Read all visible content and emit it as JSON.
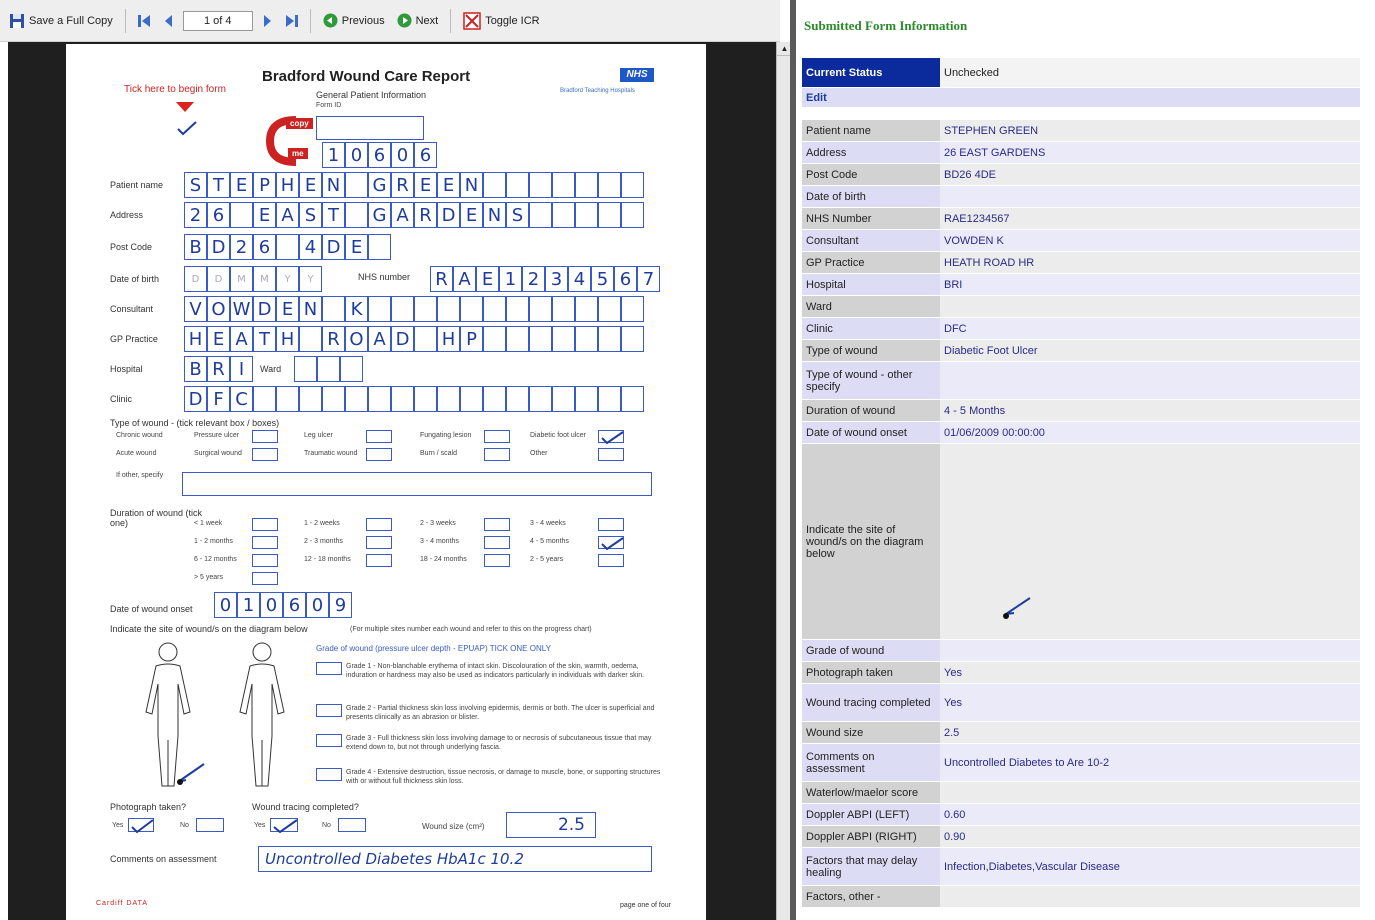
{
  "toolbar": {
    "save_label": "Save a Full Copy",
    "page_indicator": "1 of 4",
    "previous_label": "Previous",
    "next_label": "Next",
    "toggle_label": "Toggle ICR"
  },
  "form": {
    "title": "Bradford Wound Care Report",
    "subtitle": "General Patient Information",
    "tick_hint": "Tick here to begin form",
    "form_id_label": "Form ID",
    "nhs_logo": "NHS",
    "trust_name": "Bradford Teaching Hospitals",
    "copy_label": "copy",
    "me_label": "me",
    "form_id": "10606",
    "patient_name_label": "Patient name",
    "patient_name": "STEPHEN GREEN",
    "address_label": "Address",
    "address": "26 EAST GARDENS",
    "postcode_label": "Post Code",
    "postcode": "BD26 4DE",
    "dob_label": "Date of birth",
    "dob_placeholder": "DDMMYY",
    "nhs_number_label": "NHS number",
    "nhs_number": "RAE1234567",
    "consultant_label": "Consultant",
    "consultant": "VOWDEN K",
    "gp_label": "GP Practice",
    "gp": "HEATH ROAD HP",
    "hospital_label": "Hospital",
    "hospital": "BRI",
    "ward_label": "Ward",
    "clinic_label": "Clinic",
    "clinic": "DFC",
    "type_label": "Type of wound - (tick relevant box / boxes)",
    "types": [
      "Chronic wound",
      "Pressure ulcer",
      "Leg ulcer",
      "Fungating lesion",
      "Diabetic foot ulcer",
      "Acute wound",
      "Surgical wound",
      "Traumatic wound",
      "Burn / scald",
      "Other"
    ],
    "other_specify": "If other, specify",
    "duration_label": "Duration of wound (tick one)",
    "durations": [
      "< 1 week",
      "1 - 2 weeks",
      "2 - 3 weeks",
      "3 - 4 weeks",
      "1 - 2 months",
      "2 - 3 months",
      "3 - 4 months",
      "4 - 5 months",
      "6 - 12 months",
      "12 - 18 months",
      "18 - 24 months",
      "2 - 5 years",
      "> 5 years"
    ],
    "onset_label": "Date of wound onset",
    "onset": "010609",
    "site_label": "Indicate the site of wound/s on the diagram below",
    "site_note": "(For multiple sites number each wound and refer to this on the progress chart)",
    "grade_label": "Grade of wound (pressure ulcer depth - EPUAP) TICK ONE ONLY",
    "grades": [
      "Grade 1 - Non-blanchable erythema of intact skin. Discolouration of the skin, warmth, oedema, induration or hardness may also be used as indicators particularly in individuals with darker skin.",
      "Grade 2 - Partial thickness skin loss involving epidermis, dermis or both. The ulcer is superficial and presents clinically as an abrasion or blister.",
      "Grade 3 - Full thickness skin loss involving damage to or necrosis of subcutaneous tissue that may extend down to, but not through underlying fascia.",
      "Grade 4 - Extensive destruction, tissue necrosis, or damage to muscle, bone, or supporting structures with or without full thickness skin loss."
    ],
    "photo_label": "Photograph taken?",
    "tracing_label": "Wound tracing completed?",
    "yes": "Yes",
    "no": "No",
    "size_label": "Wound size (cm²)",
    "size": "2.5",
    "comments_label": "Comments on assessment",
    "comments": "Uncontrolled Diabetes HbA1c 10.2",
    "footer_left": "Cardiff DATA",
    "footer_right": "page one of four"
  },
  "panel": {
    "title": "Submitted Form Information",
    "rows": [
      {
        "k": "Current Status",
        "v": "Unchecked",
        "h": 30,
        "hdr": true
      },
      {
        "k": "Edit",
        "v": "",
        "h": 20,
        "edit": true
      },
      {
        "k": "",
        "v": "",
        "h": 12,
        "blank": true
      },
      {
        "k": "Patient name",
        "v": "STEPHEN GREEN",
        "h": 22
      },
      {
        "k": "Address",
        "v": "26 EAST GARDENS",
        "h": 22
      },
      {
        "k": "Post Code",
        "v": "BD26 4DE",
        "h": 22
      },
      {
        "k": "Date of birth",
        "v": "",
        "h": 22
      },
      {
        "k": "NHS Number",
        "v": "RAE1234567",
        "h": 22
      },
      {
        "k": "Consultant",
        "v": "VOWDEN K",
        "h": 22
      },
      {
        "k": "GP Practice",
        "v": "HEATH ROAD HR",
        "h": 22
      },
      {
        "k": "Hospital",
        "v": "BRI",
        "h": 22
      },
      {
        "k": "Ward",
        "v": "",
        "h": 22
      },
      {
        "k": "Clinic",
        "v": "DFC",
        "h": 22
      },
      {
        "k": "Type of wound",
        "v": "Diabetic Foot Ulcer",
        "h": 22
      },
      {
        "k": "Type of wound - other specify",
        "v": "",
        "h": 38
      },
      {
        "k": "Duration of wound",
        "v": "4 - 5 Months",
        "h": 22
      },
      {
        "k": "Date of wound onset",
        "v": "01/06/2009 00:00:00",
        "h": 22
      },
      {
        "k": "Indicate the site of wound/s on the diagram below",
        "v": "",
        "h": 196,
        "diagram": true
      },
      {
        "k": "Grade of wound",
        "v": "",
        "h": 22
      },
      {
        "k": "Photograph taken",
        "v": "Yes",
        "h": 22
      },
      {
        "k": "Wound tracing completed",
        "v": "Yes",
        "h": 38
      },
      {
        "k": "Wound size",
        "v": "2.5",
        "h": 22
      },
      {
        "k": "Comments on assessment",
        "v": "Uncontrolled Diabetes to Are 10-2",
        "h": 38
      },
      {
        "k": "Waterlow/maelor score",
        "v": "",
        "h": 22
      },
      {
        "k": "Doppler ABPI (LEFT)",
        "v": "0.60",
        "h": 22
      },
      {
        "k": "Doppler ABPI (RIGHT)",
        "v": "0.90",
        "h": 22
      },
      {
        "k": "Factors that may delay healing",
        "v": "Infection,Diabetes,Vascular Disease",
        "h": 38
      },
      {
        "k": "Factors, other -",
        "v": "",
        "h": 22
      }
    ]
  },
  "colors": {
    "panel_title": "#2b8a2b",
    "header_cell": "#0b2a9c",
    "handwriting": "#1e3c9c"
  }
}
